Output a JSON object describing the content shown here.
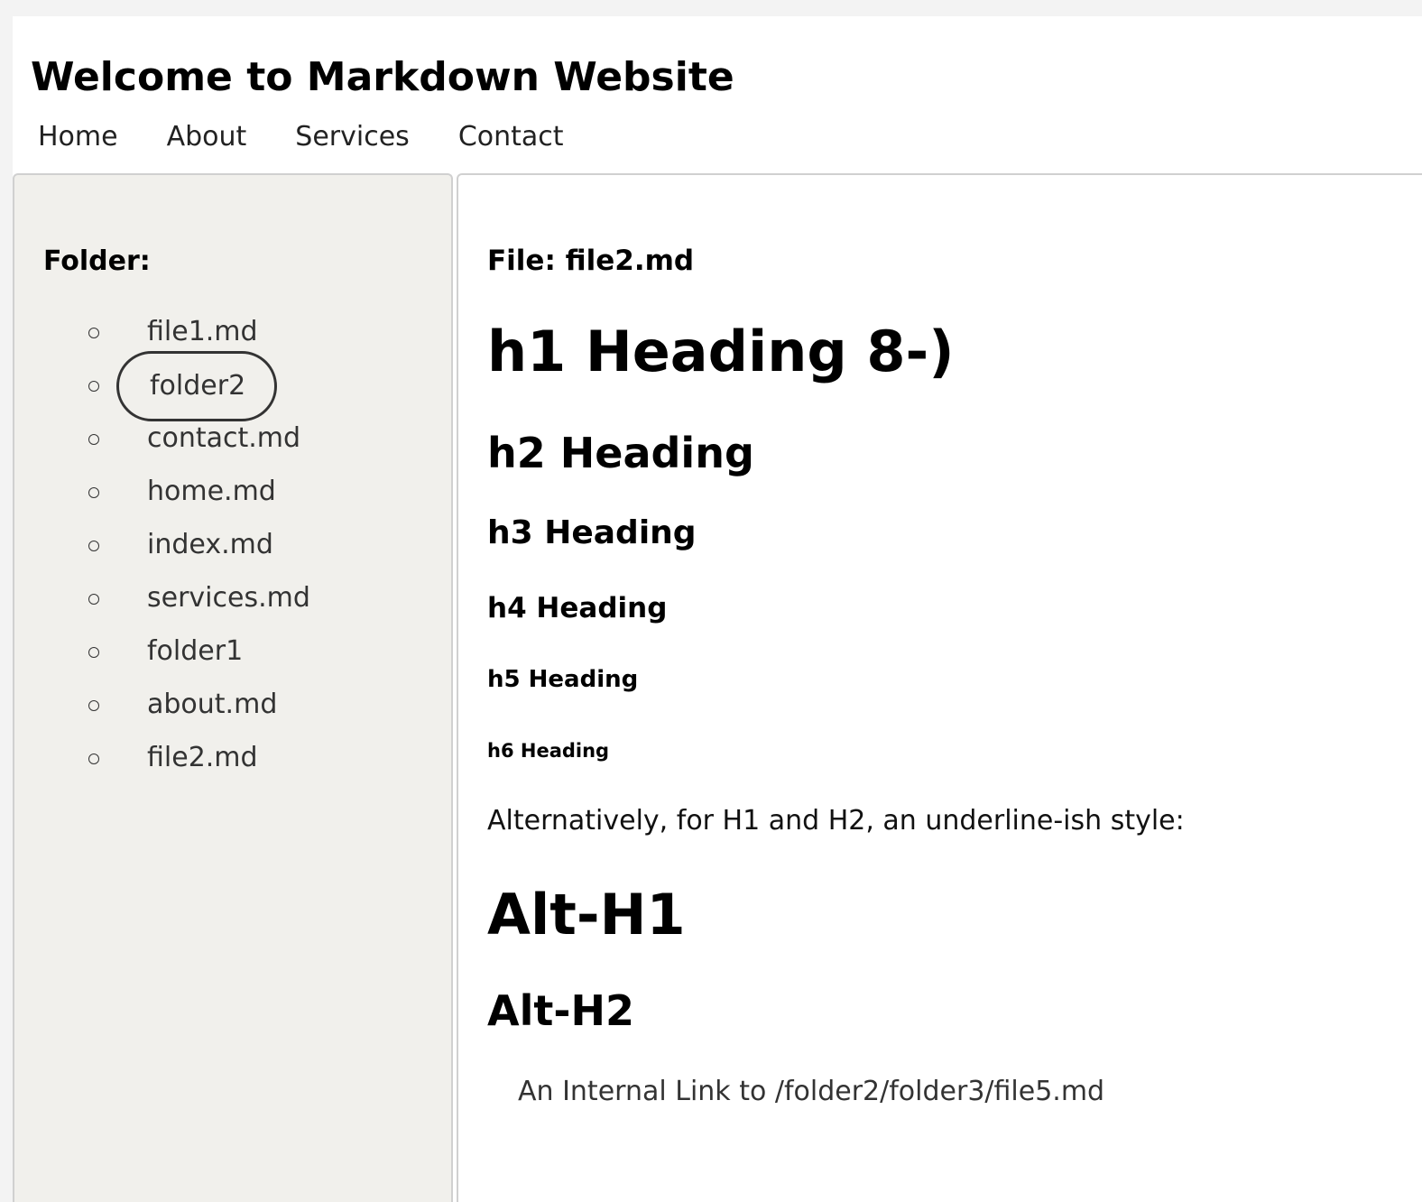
{
  "header": {
    "title": "Welcome to Markdown Website",
    "nav": [
      "Home",
      "About",
      "Services",
      "Contact"
    ]
  },
  "sidebar": {
    "label": "Folder:",
    "items": [
      {
        "label": "file1.md"
      },
      {
        "label": "folder2",
        "active": true
      },
      {
        "label": "contact.md"
      },
      {
        "label": "home.md"
      },
      {
        "label": "index.md"
      },
      {
        "label": "services.md"
      },
      {
        "label": "folder1"
      },
      {
        "label": "about.md"
      },
      {
        "label": "file2.md"
      }
    ]
  },
  "content": {
    "file_label": "File: file2.md",
    "h1": "h1 Heading 8-)",
    "h2": "h2 Heading",
    "h3": "h3 Heading",
    "h4": "h4 Heading",
    "h5": "h5 Heading",
    "h6": "h6 Heading",
    "paragraph": "Alternatively, for H1 and H2, an underline-ish style:",
    "alt_h1": "Alt-H1",
    "alt_h2": "Alt-H2",
    "internal_link": "An Internal Link to /folder2/folder3/file5.md"
  }
}
